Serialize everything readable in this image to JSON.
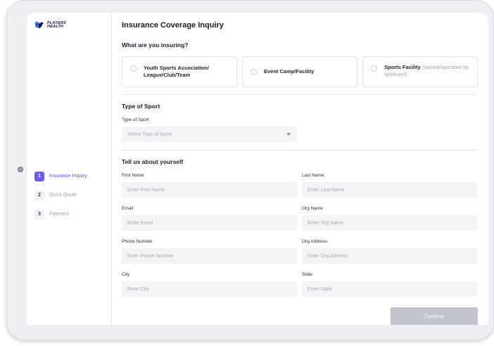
{
  "brand": {
    "name_line1": "PLAYERS",
    "name_line2": "HEALTH",
    "accent": "#6a5df5"
  },
  "steps": [
    {
      "num": "1",
      "label": "Insurance Inquiry",
      "active": true
    },
    {
      "num": "2",
      "label": "Quick Quote",
      "active": false
    },
    {
      "num": "3",
      "label": "Payment",
      "active": false
    }
  ],
  "page": {
    "title": "Insurance Coverage Inquiry"
  },
  "insuring": {
    "question": "What are you insuring?",
    "options": [
      {
        "label": "Youth Sports Association/ League/Club/Team",
        "sublabel": ""
      },
      {
        "label": "Event Camp/Facility",
        "sublabel": ""
      },
      {
        "label": "Sports Facility",
        "sublabel": "(owned/operated by applicant)"
      }
    ]
  },
  "sport": {
    "heading": "Type of Sport",
    "label": "Type of Sport",
    "placeholder": "Select Type of Sport"
  },
  "about": {
    "heading": "Tell us about yourself",
    "fields": {
      "first_name": {
        "label": "First Name",
        "placeholder": "Enter First Name"
      },
      "last_name": {
        "label": "Last Name",
        "placeholder": "Enter Last Name"
      },
      "email": {
        "label": "Email",
        "placeholder": "Enter Email"
      },
      "org_name": {
        "label": "Org Name",
        "placeholder": "Enter Org Name"
      },
      "phone": {
        "label": "Phone Number",
        "placeholder": "Enter Phone Number"
      },
      "org_address": {
        "label": "Org Address",
        "placeholder": "Enter Org Address"
      },
      "city": {
        "label": "City",
        "placeholder": "Enter City"
      },
      "state": {
        "label": "State",
        "placeholder": "Enter State"
      }
    }
  },
  "actions": {
    "continue_label": "Continue"
  }
}
